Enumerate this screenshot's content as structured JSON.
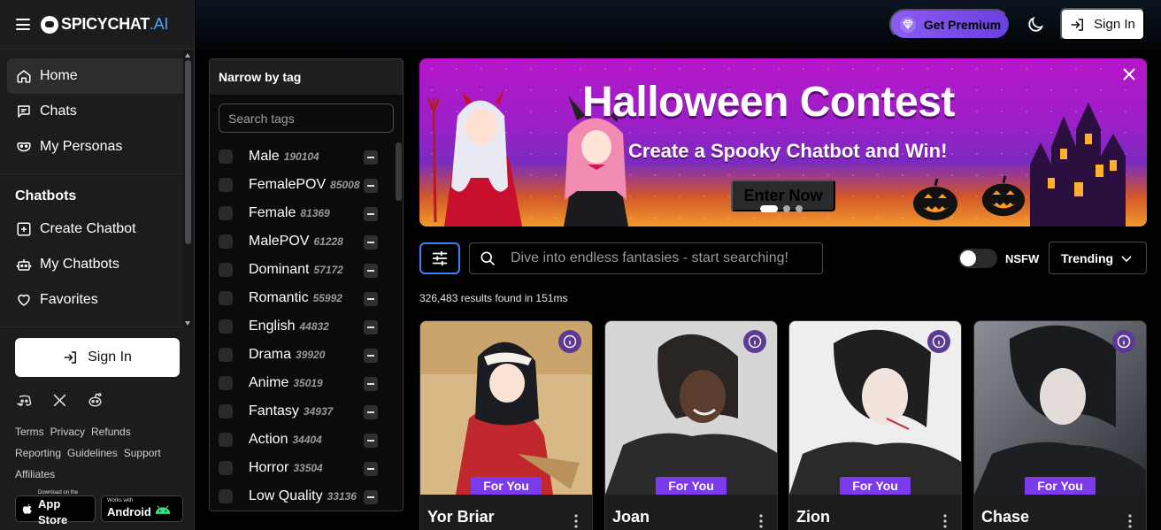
{
  "brand": {
    "name": "SPICYCHAT",
    "suffix": ".AI"
  },
  "nav": {
    "main": [
      {
        "label": "Home",
        "icon": "home-icon",
        "active": true
      },
      {
        "label": "Chats",
        "icon": "chat-icon"
      },
      {
        "label": "My Personas",
        "icon": "mask-icon"
      }
    ],
    "chatbots_title": "Chatbots",
    "chatbots": [
      {
        "label": "Create Chatbot",
        "icon": "plus-square-icon"
      },
      {
        "label": "My Chatbots",
        "icon": "robot-icon"
      },
      {
        "label": "Favorites",
        "icon": "heart-icon"
      }
    ],
    "sign_in": "Sign In"
  },
  "social_icons": [
    "discord-icon",
    "x-icon",
    "reddit-icon"
  ],
  "footer_links": [
    "Terms",
    "Privacy",
    "Refunds",
    "Reporting",
    "Guidelines",
    "Support",
    "Affiliates"
  ],
  "stores": {
    "apple": {
      "small": "Download on the",
      "big": "App Store"
    },
    "android": {
      "small": "Works with",
      "big": "Android"
    }
  },
  "topbar": {
    "premium_label": "Get Premium",
    "sign_in": "Sign In",
    "theme_icon": "moon-icon"
  },
  "tags": {
    "title": "Narrow by tag",
    "search_placeholder": "Search tags",
    "items": [
      {
        "name": "Male",
        "count": "190104"
      },
      {
        "name": "FemalePOV",
        "count": "85008"
      },
      {
        "name": "Female",
        "count": "81369"
      },
      {
        "name": "MalePOV",
        "count": "61228"
      },
      {
        "name": "Dominant",
        "count": "57172"
      },
      {
        "name": "Romantic",
        "count": "55992"
      },
      {
        "name": "English",
        "count": "44832"
      },
      {
        "name": "Drama",
        "count": "39920"
      },
      {
        "name": "Anime",
        "count": "35019"
      },
      {
        "name": "Fantasy",
        "count": "34937"
      },
      {
        "name": "Action",
        "count": "34404"
      },
      {
        "name": "Horror",
        "count": "33504"
      },
      {
        "name": "Low Quality",
        "count": "33136"
      }
    ]
  },
  "banner": {
    "title": "Halloween Contest",
    "subtitle": "Create a Spooky Chatbot and Win!",
    "cta": "Enter Now",
    "slides": 3,
    "active_slide": 1
  },
  "search": {
    "placeholder": "Dive into endless fantasies - start searching!",
    "nsfw_label": "NSFW",
    "nsfw_on": false,
    "sort_value": "Trending",
    "results_text": "326,483 results found in 151ms"
  },
  "cards": [
    {
      "name": "Yor Briar",
      "badge": "For You"
    },
    {
      "name": "Joan",
      "badge": "For You"
    },
    {
      "name": "Zion",
      "badge": "For You"
    },
    {
      "name": "Chase",
      "badge": "For You"
    }
  ],
  "colors": {
    "accent": "#7c3aed",
    "link": "#3b82f6",
    "premium": "#8c5cf2"
  }
}
